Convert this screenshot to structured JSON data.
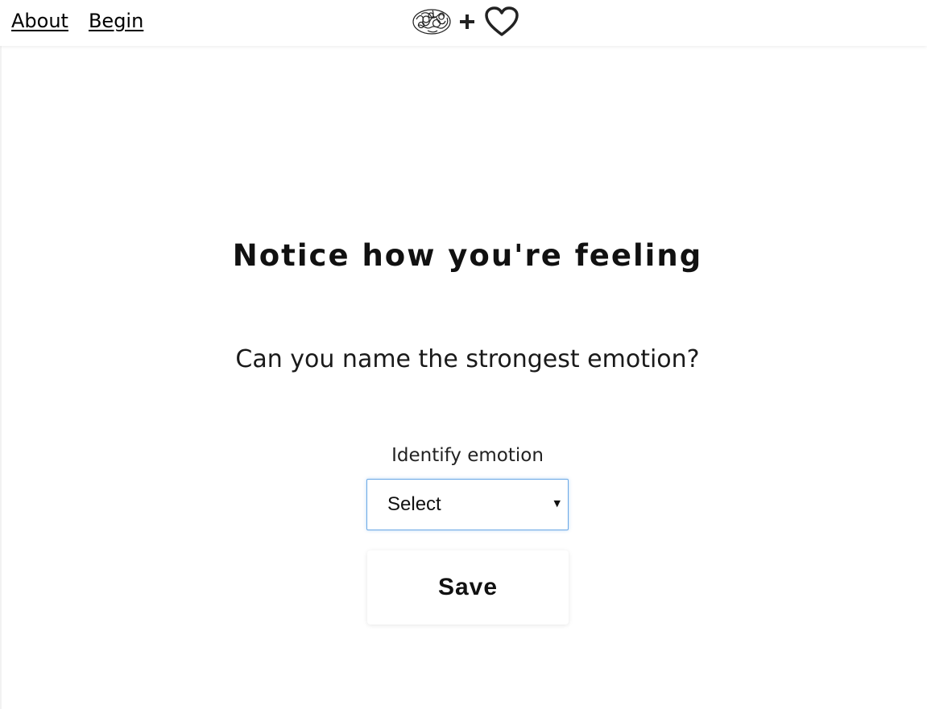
{
  "nav": {
    "items": [
      {
        "label": "About"
      },
      {
        "label": "Begin"
      }
    ]
  },
  "logo": {
    "icons": [
      "brain-icon",
      "plus-icon",
      "heart-icon"
    ]
  },
  "main": {
    "heading": "Notice how you're feeling",
    "question": "Can you name the strongest emotion?",
    "emotion_field": {
      "label": "Identify emotion",
      "selected_value": "Select"
    },
    "save_label": "Save"
  },
  "colors": {
    "text": "#111111",
    "select_focus_border": "#6aa8e6",
    "background": "#ffffff"
  }
}
